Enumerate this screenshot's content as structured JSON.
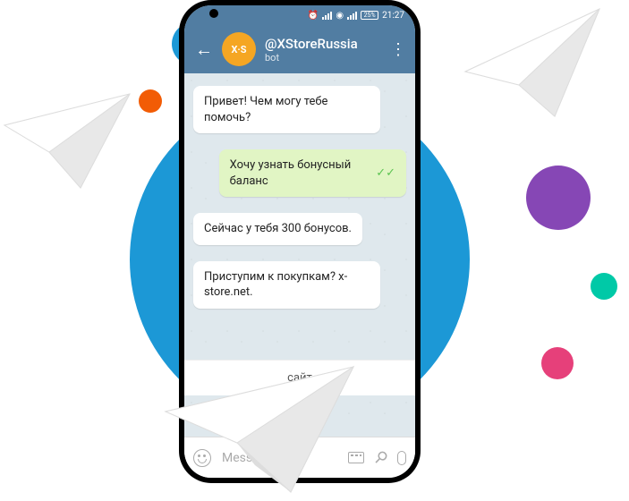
{
  "status": {
    "battery": "25%",
    "time": "21:27"
  },
  "header": {
    "bot_name": "@XStoreRussia",
    "bot_sub": "bot",
    "avatar_text": "X·S"
  },
  "messages": {
    "m1": "Привет! Чем могу тебе помочь?",
    "m2": "Хочу узнать бонусный баланс",
    "m3": "Сейчас у тебя 300 бонусов.",
    "m4": "Приступим к покупкам? x-store.net."
  },
  "input": {
    "placeholder": "Message"
  },
  "keyboard_button": "сайт"
}
